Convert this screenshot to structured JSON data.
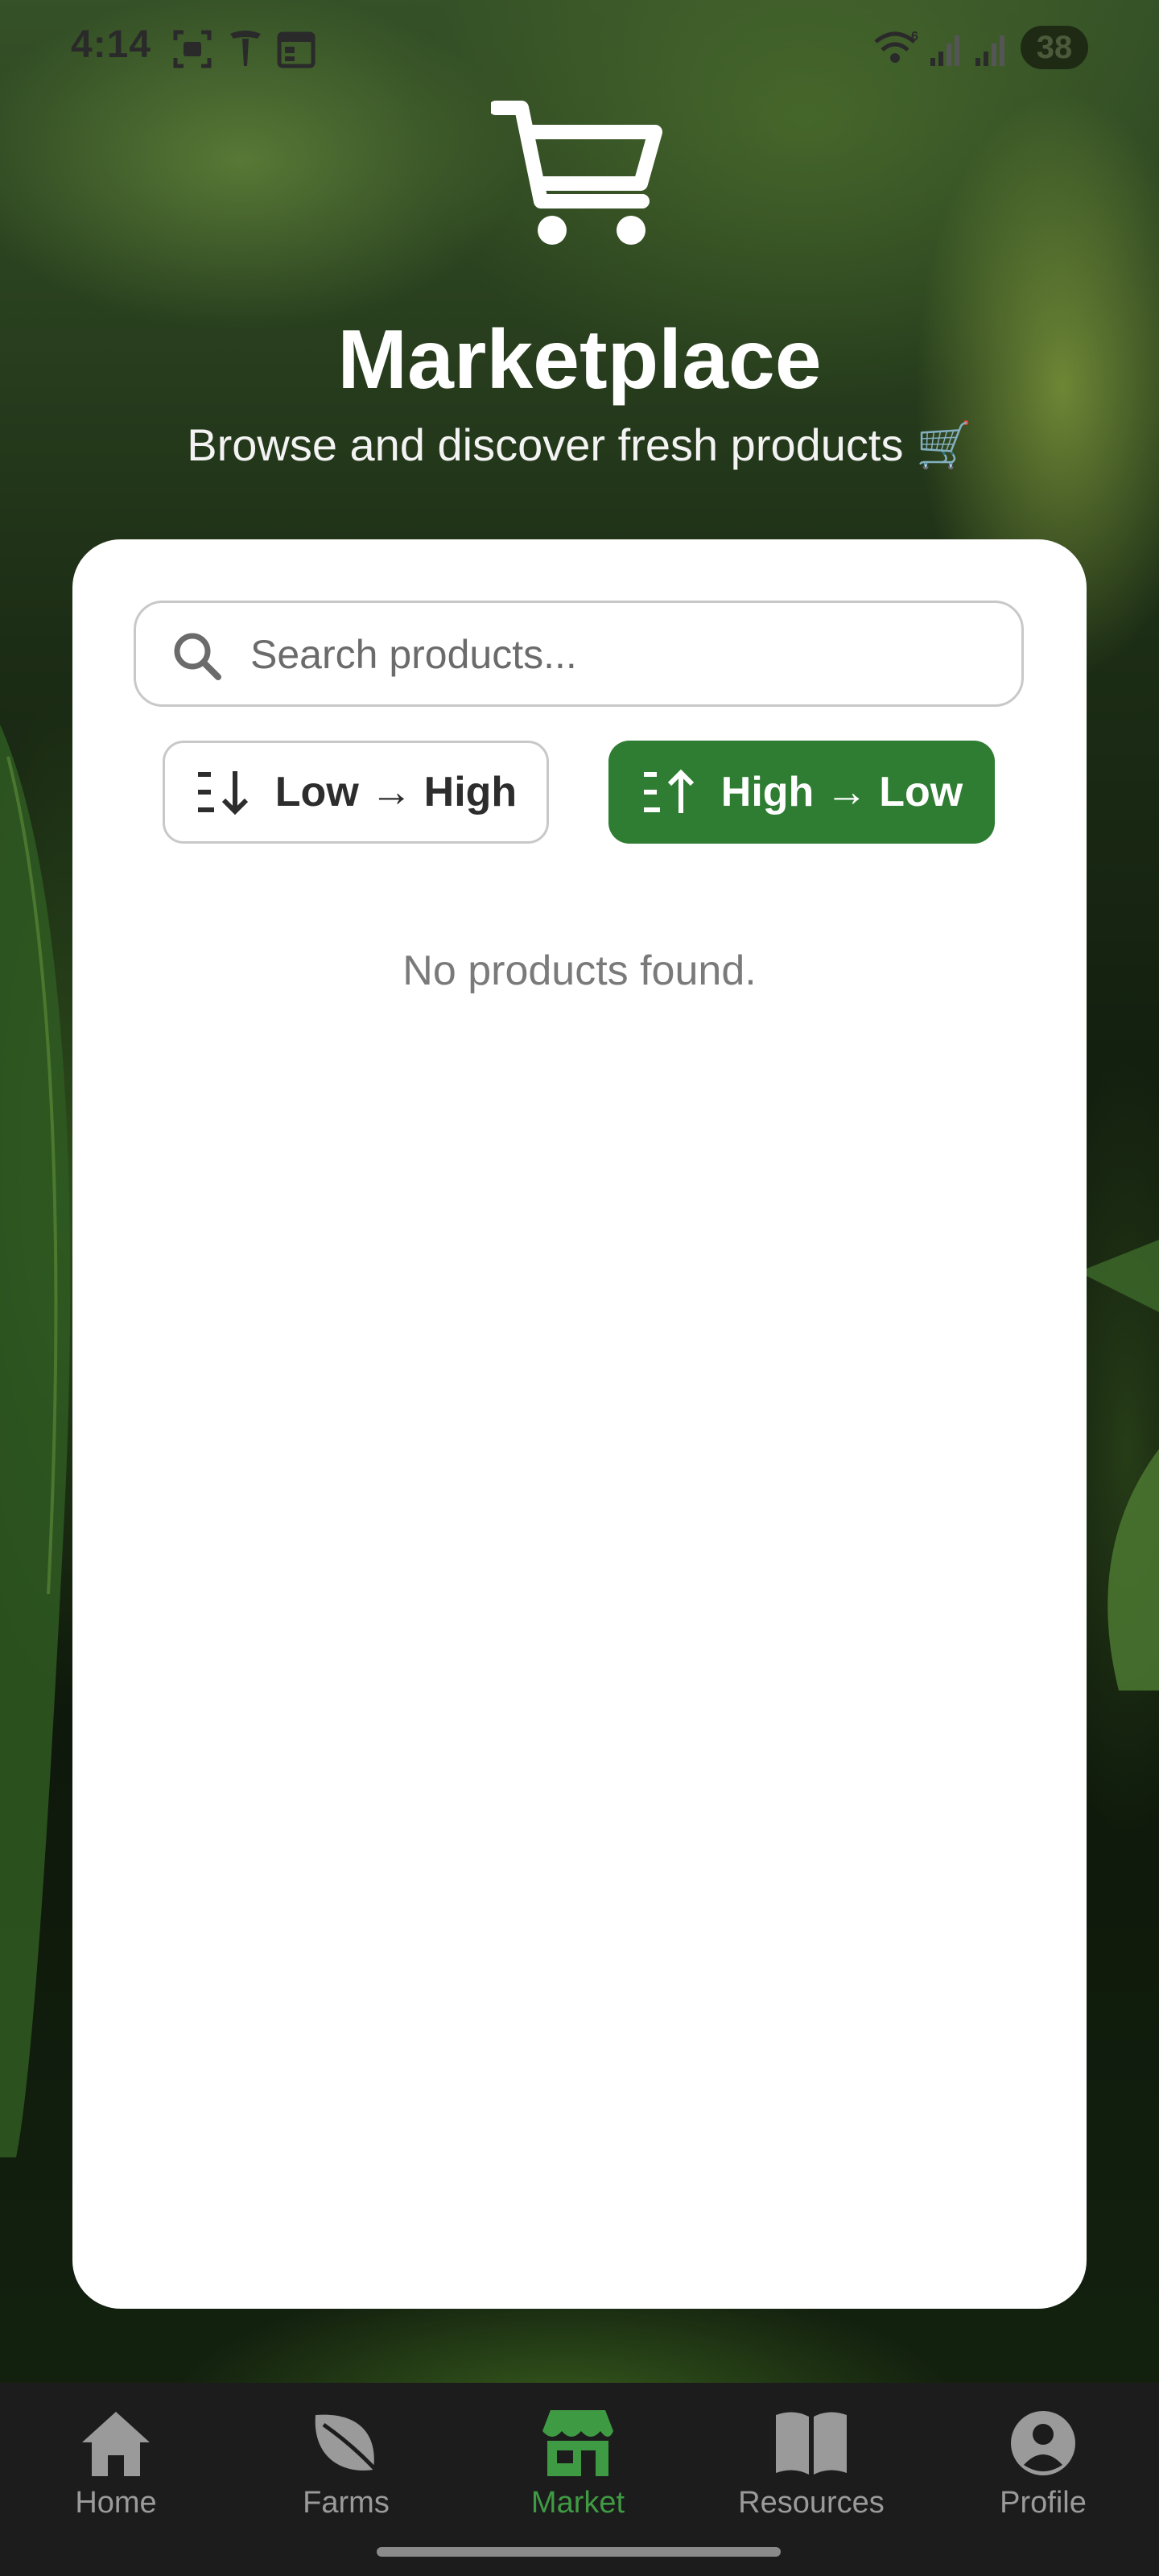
{
  "status_bar": {
    "time": "4:14",
    "battery": "38",
    "icons": [
      "screenshot-icon",
      "tesla-icon",
      "calendar-icon",
      "wifi-icon",
      "signal-icon",
      "signal-icon"
    ]
  },
  "header": {
    "icon": "cart-icon",
    "title": "Marketplace",
    "subtitle": "Browse and discover fresh products 🛒"
  },
  "search": {
    "placeholder": "Search products...",
    "value": ""
  },
  "sort": {
    "low_label": "Low → High",
    "high_label": "High → Low",
    "selected": "high"
  },
  "empty_message": "No products found.",
  "nav": {
    "items": [
      {
        "label": "Home",
        "icon": "home-icon"
      },
      {
        "label": "Farms",
        "icon": "leaf-icon"
      },
      {
        "label": "Market",
        "icon": "store-icon",
        "active": true
      },
      {
        "label": "Resources",
        "icon": "book-icon"
      },
      {
        "label": "Profile",
        "icon": "user-icon"
      }
    ]
  },
  "colors": {
    "accent": "#2e7d32",
    "nav_active": "#3f9b43",
    "nav_inactive": "#9a9a9a",
    "nav_bg": "#1c1c1c"
  }
}
